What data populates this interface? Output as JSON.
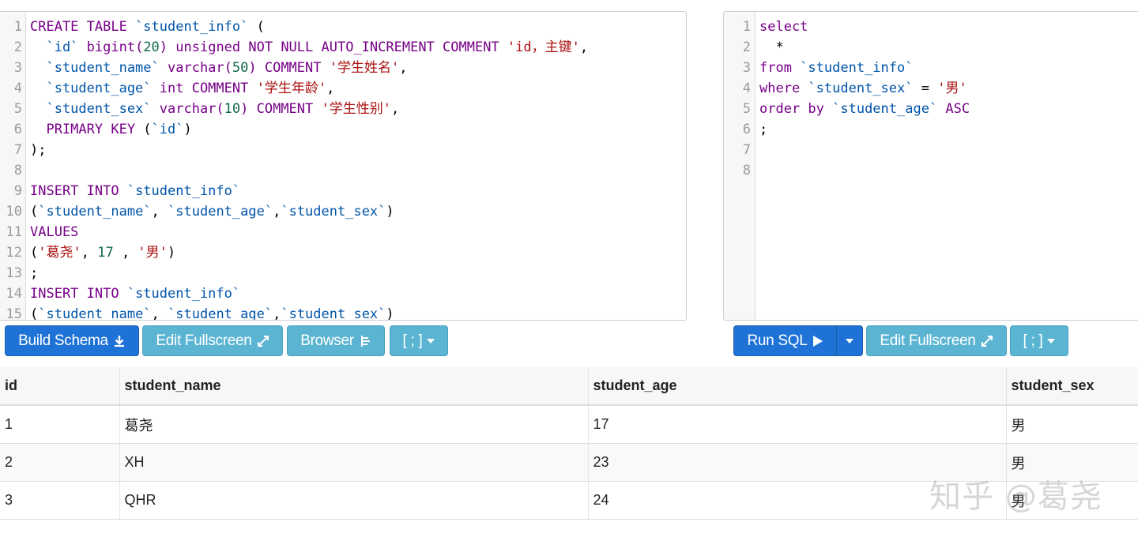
{
  "schema_editor": {
    "lines": [
      {
        "n": "1",
        "tokens": [
          {
            "t": "CREATE TABLE ",
            "c": "kw"
          },
          {
            "t": "`student_info`",
            "c": "id"
          },
          {
            "t": " (",
            "c": "pun"
          }
        ]
      },
      {
        "n": "2",
        "tokens": [
          {
            "t": "  `id`",
            "c": "id"
          },
          {
            "t": " bigint(",
            "c": "kw"
          },
          {
            "t": "20",
            "c": "num"
          },
          {
            "t": ") unsigned NOT NULL AUTO_INCREMENT COMMENT ",
            "c": "kw"
          },
          {
            "t": "'id，主键'",
            "c": "str"
          },
          {
            "t": ",",
            "c": "pun"
          }
        ]
      },
      {
        "n": "3",
        "tokens": [
          {
            "t": "  `student_name`",
            "c": "id"
          },
          {
            "t": " varchar(",
            "c": "kw"
          },
          {
            "t": "50",
            "c": "num"
          },
          {
            "t": ") COMMENT ",
            "c": "kw"
          },
          {
            "t": "'学生姓名'",
            "c": "str"
          },
          {
            "t": ",",
            "c": "pun"
          }
        ]
      },
      {
        "n": "4",
        "tokens": [
          {
            "t": "  `student_age`",
            "c": "id"
          },
          {
            "t": " int COMMENT ",
            "c": "kw"
          },
          {
            "t": "'学生年龄'",
            "c": "str"
          },
          {
            "t": ",",
            "c": "pun"
          }
        ]
      },
      {
        "n": "5",
        "tokens": [
          {
            "t": "  `student_sex`",
            "c": "id"
          },
          {
            "t": " varchar(",
            "c": "kw"
          },
          {
            "t": "10",
            "c": "num"
          },
          {
            "t": ") COMMENT ",
            "c": "kw"
          },
          {
            "t": "'学生性别'",
            "c": "str"
          },
          {
            "t": ",",
            "c": "pun"
          }
        ]
      },
      {
        "n": "6",
        "tokens": [
          {
            "t": "  PRIMARY KEY ",
            "c": "kw"
          },
          {
            "t": "(",
            "c": "pun"
          },
          {
            "t": "`id`",
            "c": "id"
          },
          {
            "t": ")",
            "c": "pun"
          }
        ]
      },
      {
        "n": "7",
        "tokens": [
          {
            "t": ");",
            "c": "pun"
          }
        ]
      },
      {
        "n": "8",
        "tokens": []
      },
      {
        "n": "9",
        "tokens": [
          {
            "t": "INSERT INTO ",
            "c": "kw"
          },
          {
            "t": "`student_info`",
            "c": "id"
          }
        ]
      },
      {
        "n": "10",
        "tokens": [
          {
            "t": "(",
            "c": "pun"
          },
          {
            "t": "`student_name`",
            "c": "id"
          },
          {
            "t": ", ",
            "c": "pun"
          },
          {
            "t": "`student_age`",
            "c": "id"
          },
          {
            "t": ",",
            "c": "pun"
          },
          {
            "t": "`student_sex`",
            "c": "id"
          },
          {
            "t": ")",
            "c": "pun"
          }
        ]
      },
      {
        "n": "11",
        "tokens": [
          {
            "t": "VALUES",
            "c": "kw"
          }
        ]
      },
      {
        "n": "12",
        "tokens": [
          {
            "t": "(",
            "c": "pun"
          },
          {
            "t": "'葛尧'",
            "c": "str"
          },
          {
            "t": ", ",
            "c": "pun"
          },
          {
            "t": "17",
            "c": "num"
          },
          {
            "t": " , ",
            "c": "pun"
          },
          {
            "t": "'男'",
            "c": "str"
          },
          {
            "t": ")",
            "c": "pun"
          }
        ]
      },
      {
        "n": "13",
        "tokens": [
          {
            "t": ";",
            "c": "pun"
          }
        ]
      },
      {
        "n": "14",
        "tokens": [
          {
            "t": "INSERT INTO ",
            "c": "kw"
          },
          {
            "t": "`student_info`",
            "c": "id"
          }
        ]
      },
      {
        "n": "15",
        "tokens": [
          {
            "t": "(",
            "c": "pun"
          },
          {
            "t": "`student_name`",
            "c": "id"
          },
          {
            "t": ", ",
            "c": "pun"
          },
          {
            "t": "`student_age`",
            "c": "id"
          },
          {
            "t": ",",
            "c": "pun"
          },
          {
            "t": "`student_sex`",
            "c": "id"
          },
          {
            "t": ")",
            "c": "pun"
          }
        ]
      }
    ]
  },
  "query_editor": {
    "lines": [
      {
        "n": "1",
        "tokens": [
          {
            "t": "select",
            "c": "kw"
          }
        ]
      },
      {
        "n": "2",
        "tokens": [
          {
            "t": "  *",
            "c": "pun"
          }
        ]
      },
      {
        "n": "3",
        "tokens": [
          {
            "t": "from ",
            "c": "kw"
          },
          {
            "t": "`student_info`",
            "c": "id"
          }
        ]
      },
      {
        "n": "4",
        "tokens": [
          {
            "t": "where ",
            "c": "kw"
          },
          {
            "t": "`student_sex`",
            "c": "id"
          },
          {
            "t": " = ",
            "c": "pun"
          },
          {
            "t": "'男'",
            "c": "str"
          }
        ]
      },
      {
        "n": "5",
        "tokens": [
          {
            "t": "order by ",
            "c": "kw"
          },
          {
            "t": "`student_age`",
            "c": "id"
          },
          {
            "t": " ASC",
            "c": "kw"
          }
        ]
      },
      {
        "n": "6",
        "tokens": [
          {
            "t": ";",
            "c": "pun"
          }
        ]
      },
      {
        "n": "7",
        "tokens": []
      },
      {
        "n": "8",
        "tokens": []
      }
    ]
  },
  "toolbar_left": {
    "build_schema": "Build Schema",
    "edit_fullscreen": "Edit Fullscreen",
    "browser": "Browser",
    "delimiter": "[ ; ]"
  },
  "toolbar_right": {
    "run_sql": "Run SQL",
    "edit_fullscreen": "Edit Fullscreen",
    "delimiter": "[ ; ]"
  },
  "results": {
    "columns": [
      "id",
      "student_name",
      "student_age",
      "student_sex"
    ],
    "rows": [
      [
        "1",
        "葛尧",
        "17",
        "男"
      ],
      [
        "2",
        "XH",
        "23",
        "男"
      ],
      [
        "3",
        "QHR",
        "24",
        "男"
      ]
    ]
  },
  "watermark": "知乎 @葛尧",
  "colors": {
    "primary_button": "#1f73d6",
    "info_button": "#5bb5d2",
    "keyword": "#770088",
    "identifier": "#0055aa",
    "string": "#aa1111",
    "number": "#116644"
  }
}
